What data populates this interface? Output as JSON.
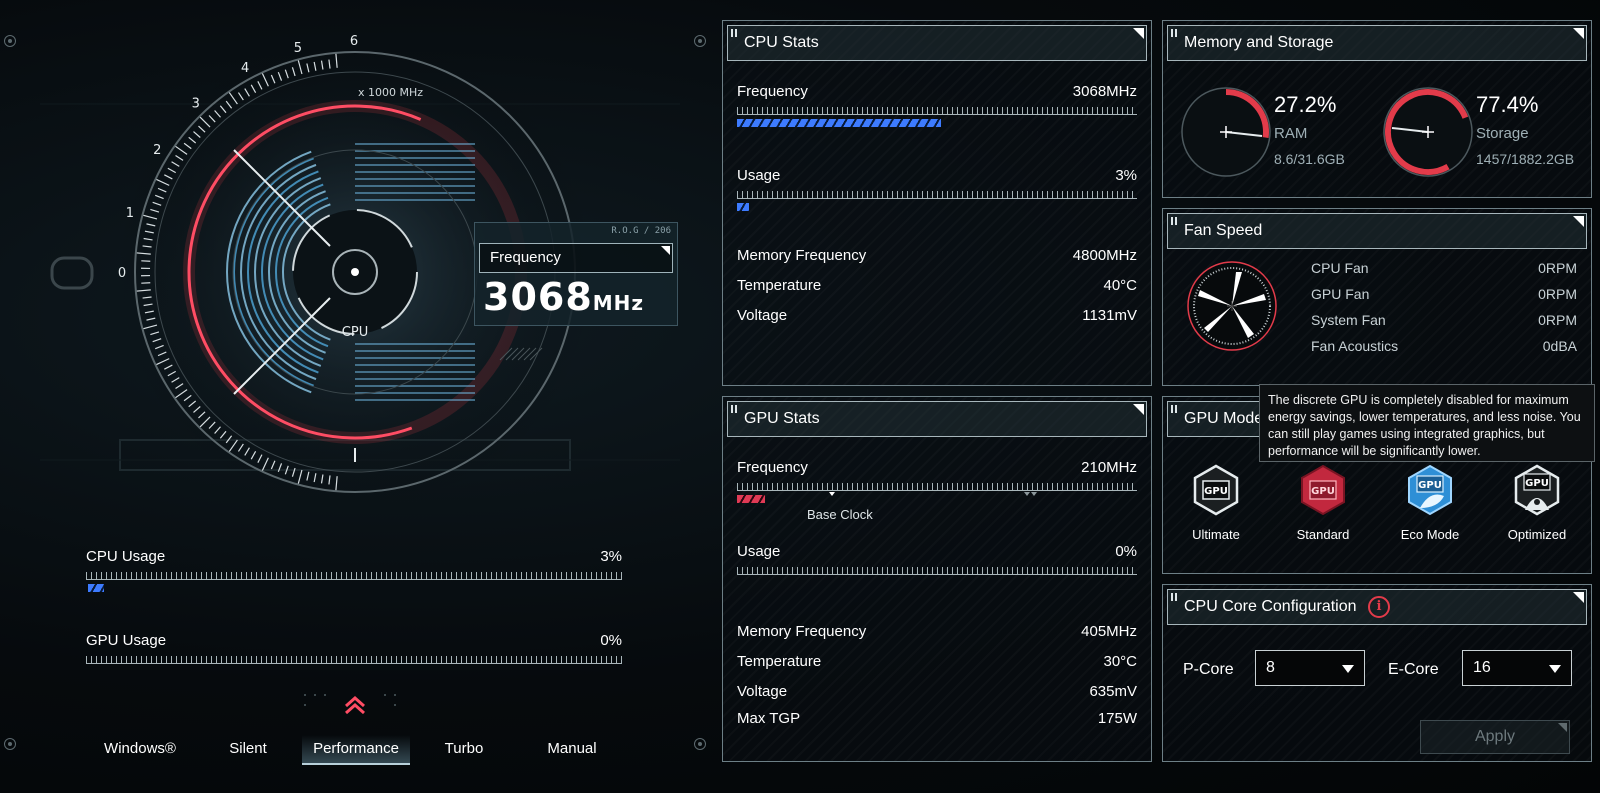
{
  "gauge": {
    "center_label": "CPU",
    "scale_label": "x 1000 MHz",
    "scale_ticks": [
      "0",
      "1",
      "2",
      "3",
      "4",
      "5",
      "6"
    ],
    "badge": "R.O.G / 206",
    "readout_label": "Frequency",
    "readout_value": "3068",
    "readout_unit": "MHz",
    "frequency_fraction": 0.511
  },
  "usage": {
    "cpu_label": "CPU Usage",
    "cpu_value": "3%",
    "cpu_fraction": 0.03,
    "gpu_label": "GPU Usage",
    "gpu_value": "0%",
    "gpu_fraction": 0.0
  },
  "modes": {
    "items": [
      "Windows®",
      "Silent",
      "Performance",
      "Turbo",
      "Manual"
    ],
    "active": "Performance"
  },
  "cpu_stats": {
    "title": "CPU Stats",
    "frequency_label": "Frequency",
    "frequency_value": "3068MHz",
    "frequency_fraction": 0.51,
    "usage_label": "Usage",
    "usage_value": "3%",
    "usage_fraction": 0.03,
    "memfreq_label": "Memory Frequency",
    "memfreq_value": "4800MHz",
    "temp_label": "Temperature",
    "temp_value": "40°C",
    "voltage_label": "Voltage",
    "voltage_value": "1131mV"
  },
  "gpu_stats": {
    "title": "GPU Stats",
    "frequency_label": "Frequency",
    "frequency_value": "210MHz",
    "frequency_fraction": 0.07,
    "base_clock_label": "Base Clock",
    "usage_label": "Usage",
    "usage_value": "0%",
    "usage_fraction": 0.0,
    "memfreq_label": "Memory Frequency",
    "memfreq_value": "405MHz",
    "temp_label": "Temperature",
    "temp_value": "30°C",
    "voltage_label": "Voltage",
    "voltage_value": "635mV",
    "tgp_label": "Max TGP",
    "tgp_value": "175W"
  },
  "memory": {
    "title": "Memory and Storage",
    "ram_percent": "27.2%",
    "ram_fraction": 0.272,
    "ram_label": "RAM",
    "ram_detail": "8.6/31.6GB",
    "storage_percent": "77.4%",
    "storage_fraction": 0.774,
    "storage_label": "Storage",
    "storage_detail": "1457/1882.2GB"
  },
  "fan": {
    "title": "Fan Speed",
    "rows": [
      {
        "label": "CPU Fan",
        "value": "0RPM"
      },
      {
        "label": "GPU Fan",
        "value": "0RPM"
      },
      {
        "label": "System Fan",
        "value": "0RPM"
      },
      {
        "label": "Fan Acoustics",
        "value": "0dBA"
      }
    ]
  },
  "gpu_mode": {
    "title": "GPU Mode",
    "tooltip": "The discrete GPU is completely disabled for maximum energy savings, lower temperatures, and less noise. You can still play games using integrated graphics, but performance will be significantly lower.",
    "icon_text": "GPU",
    "modes": [
      "Ultimate",
      "Standard",
      "Eco Mode",
      "Optimized"
    ]
  },
  "cpu_core": {
    "title": "CPU Core Configuration",
    "pcore_label": "P-Core",
    "pcore_value": "8",
    "ecore_label": "E-Core",
    "ecore_value": "16",
    "apply_label": "Apply"
  },
  "colors": {
    "accent_red": "#e23b4a",
    "accent_blue": "#3d7bff",
    "panel_border": "#6d7f86"
  }
}
